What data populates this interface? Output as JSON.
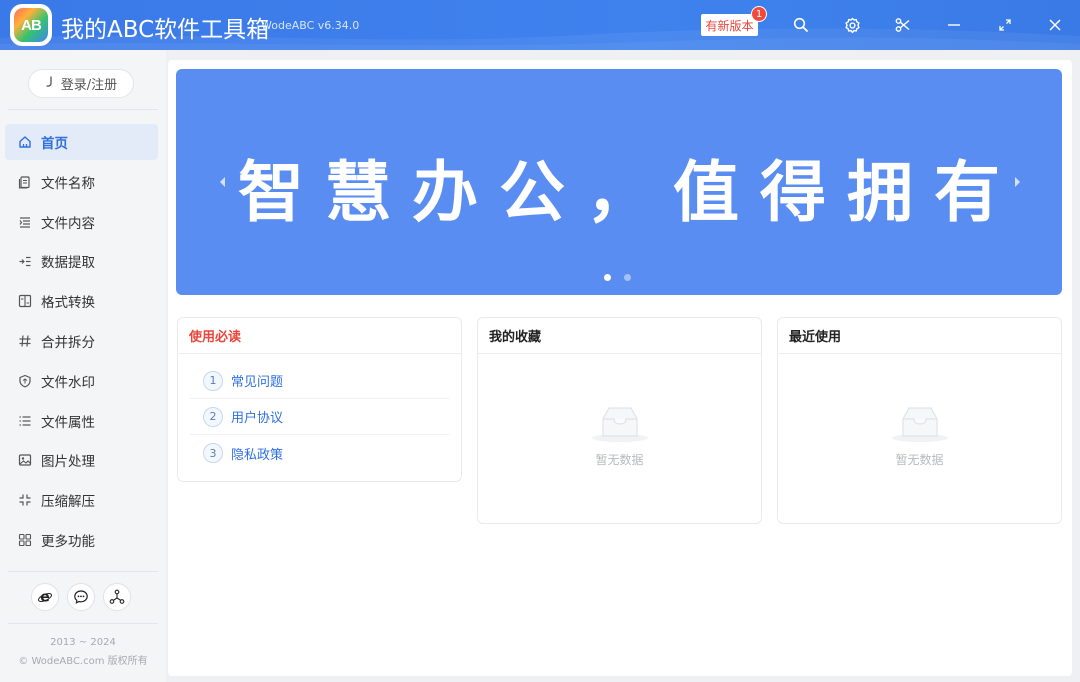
{
  "app": {
    "logo_text": "AB",
    "title": "我的ABC软件工具箱",
    "version": "WodeABC v6.34.0",
    "new_version_label": "有新版本",
    "new_version_badge": "1"
  },
  "titlebar_icons": [
    "search-icon",
    "settings-icon",
    "scissors-icon",
    "minimize-icon",
    "fullscreen-icon",
    "close-icon"
  ],
  "sidebar": {
    "login_label": "登录/注册",
    "items": [
      {
        "label": "首页",
        "icon": "home-icon",
        "active": true
      },
      {
        "label": "文件名称",
        "icon": "file-name-icon"
      },
      {
        "label": "文件内容",
        "icon": "file-content-icon"
      },
      {
        "label": "数据提取",
        "icon": "data-extract-icon"
      },
      {
        "label": "格式转换",
        "icon": "format-convert-icon"
      },
      {
        "label": "合并拆分",
        "icon": "merge-split-icon"
      },
      {
        "label": "文件水印",
        "icon": "watermark-icon"
      },
      {
        "label": "文件属性",
        "icon": "file-properties-icon"
      },
      {
        "label": "图片处理",
        "icon": "image-icon"
      },
      {
        "label": "压缩解压",
        "icon": "compress-icon"
      },
      {
        "label": "更多功能",
        "icon": "more-functions-icon"
      }
    ],
    "social_icons": [
      "browser-icon",
      "chat-icon",
      "share-network-icon"
    ],
    "copyright_years": "2013 ~ 2024",
    "copyright_text": "© WodeABC.com 版权所有"
  },
  "banner": {
    "slogan": "智慧办公，值得拥有",
    "slides": 2,
    "active_slide": 1,
    "color": "#5a8df2"
  },
  "guide": {
    "title": "使用必读",
    "items": [
      {
        "num": "1",
        "label": "常见问题"
      },
      {
        "num": "2",
        "label": "用户协议"
      },
      {
        "num": "3",
        "label": "隐私政策"
      }
    ]
  },
  "favorites": {
    "title": "我的收藏",
    "empty_text": "暂无数据"
  },
  "recent": {
    "title": "最近使用",
    "empty_text": "暂无数据"
  },
  "colors": {
    "accent": "#3a7ae6",
    "danger": "#e8453c",
    "link": "#2f6fe0"
  }
}
